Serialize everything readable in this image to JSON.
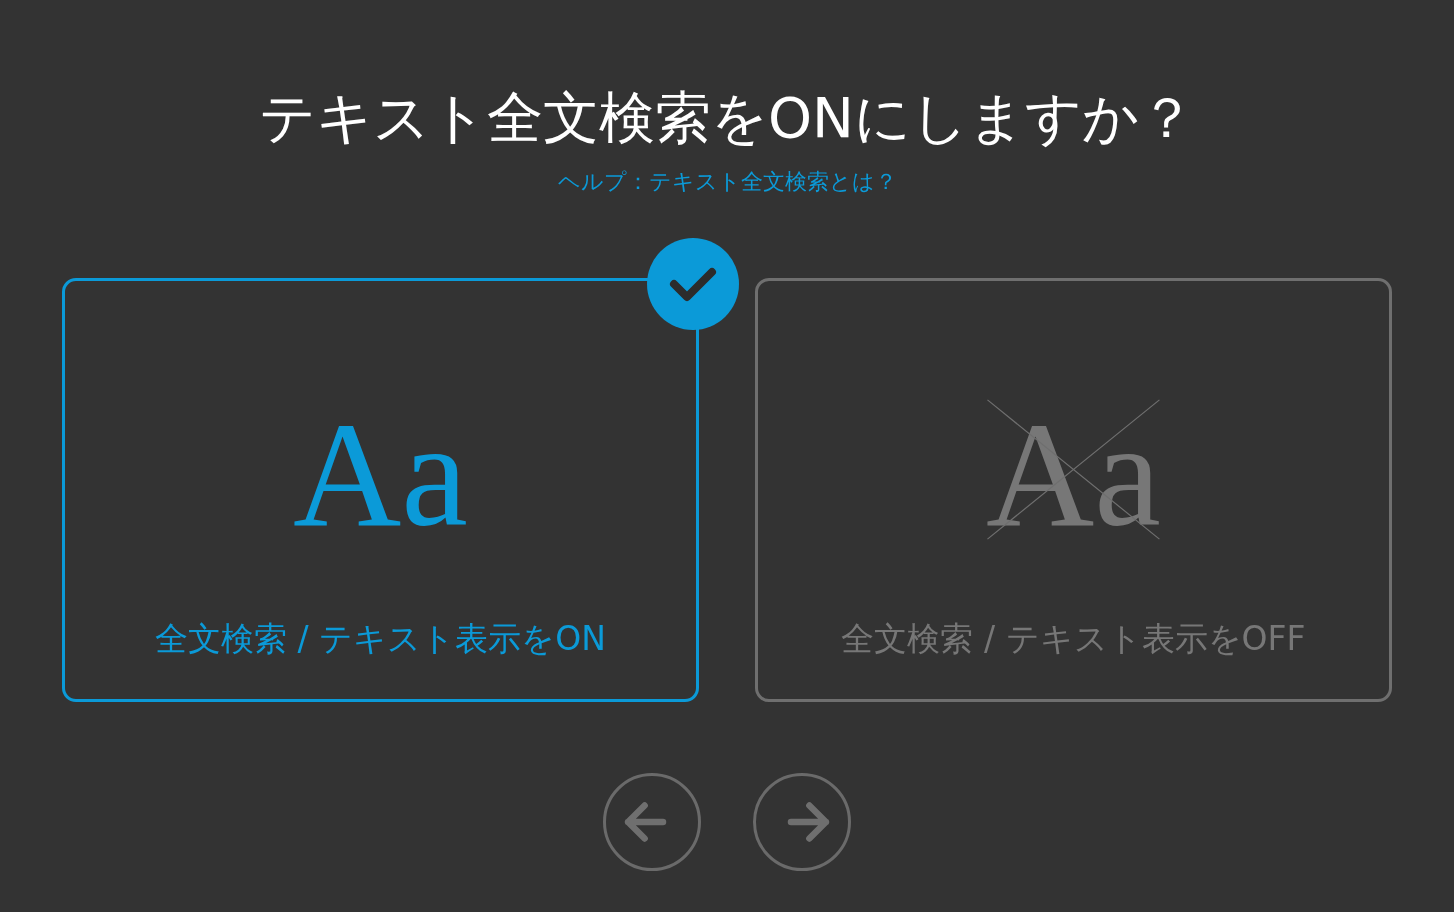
{
  "title": "テキスト全文検索をONにしますか？",
  "help_link": "ヘルプ：テキスト全文検索とは？",
  "options": [
    {
      "glyph": "Aa",
      "label": "全文検索 / テキスト表示をON",
      "selected": true,
      "crossed": false
    },
    {
      "glyph": "Aa",
      "label": "全文検索 / テキスト表示をOFF",
      "selected": false,
      "crossed": true
    }
  ],
  "nav": [
    {
      "kind": "back"
    },
    {
      "kind": "forward"
    }
  ]
}
